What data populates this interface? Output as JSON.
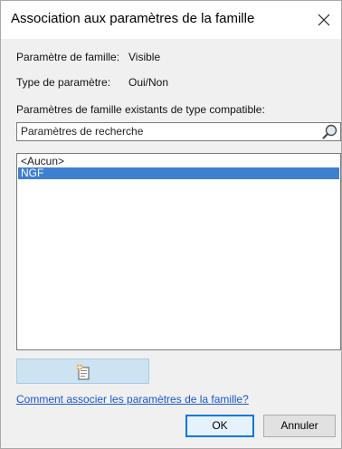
{
  "window": {
    "title": "Association aux paramètres de la famille",
    "close_icon": "close-icon"
  },
  "info": {
    "family_param_label": "Paramètre de famille:",
    "family_param_value": "Visible",
    "param_type_label": "Type de paramètre:",
    "param_type_value": "Oui/Non",
    "existing_label": "Paramètres de famille existants de type compatible:"
  },
  "search": {
    "value": "Paramètres de recherche",
    "icon": "magnifier-icon"
  },
  "list": {
    "items": [
      "<Aucun>",
      "NGF"
    ],
    "selected_index": 1,
    "selection_color": "#3f7fcf"
  },
  "new_param_button": {
    "icon": "new-parameter-icon"
  },
  "help_link": "Comment associer les paramètres de la famille?",
  "buttons": {
    "ok": "OK",
    "cancel": "Annuler"
  }
}
